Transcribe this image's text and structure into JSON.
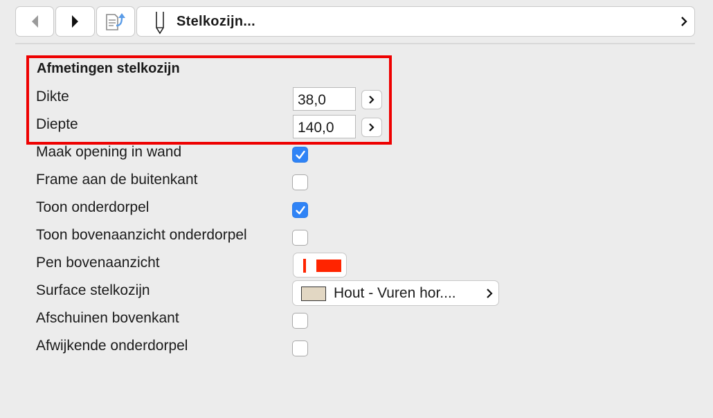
{
  "toolbar": {
    "back_icon": "chevron-left-icon",
    "forward_icon": "chevron-right-icon",
    "document_icon": "document-arrow-icon",
    "path_icon": "pencil-icon",
    "path_title": "Stelkozijn...",
    "path_chevron_icon": "chevron-right-icon"
  },
  "dimensions": {
    "title": "Afmetingen stelkozijn",
    "dikte": {
      "label": "Dikte",
      "value": "38,0"
    },
    "diepte": {
      "label": "Diepte",
      "value": "140,0"
    }
  },
  "options": {
    "maak_opening": {
      "label": "Maak opening in wand",
      "checked": true
    },
    "frame_buitenkant": {
      "label": "Frame aan de buitenkant",
      "checked": false
    },
    "toon_onderdorpel": {
      "label": "Toon onderdorpel",
      "checked": true
    },
    "toon_bovenaanzicht": {
      "label": "Toon bovenaanzicht onderdorpel",
      "checked": false
    },
    "pen_bovenaanzicht": {
      "label": "Pen bovenaanzicht",
      "color": "#ff2400"
    },
    "surface": {
      "label": "Surface stelkozijn",
      "value": "Hout - Vuren hor....",
      "swatch": "#e2d7c3"
    },
    "afschuinen": {
      "label": "Afschuinen bovenkant",
      "checked": false
    },
    "afwijkende": {
      "label": "Afwijkende onderdorpel",
      "checked": false
    }
  },
  "colors": {
    "highlight": "#ee0000",
    "checkbox_accent": "#2f83f6"
  }
}
